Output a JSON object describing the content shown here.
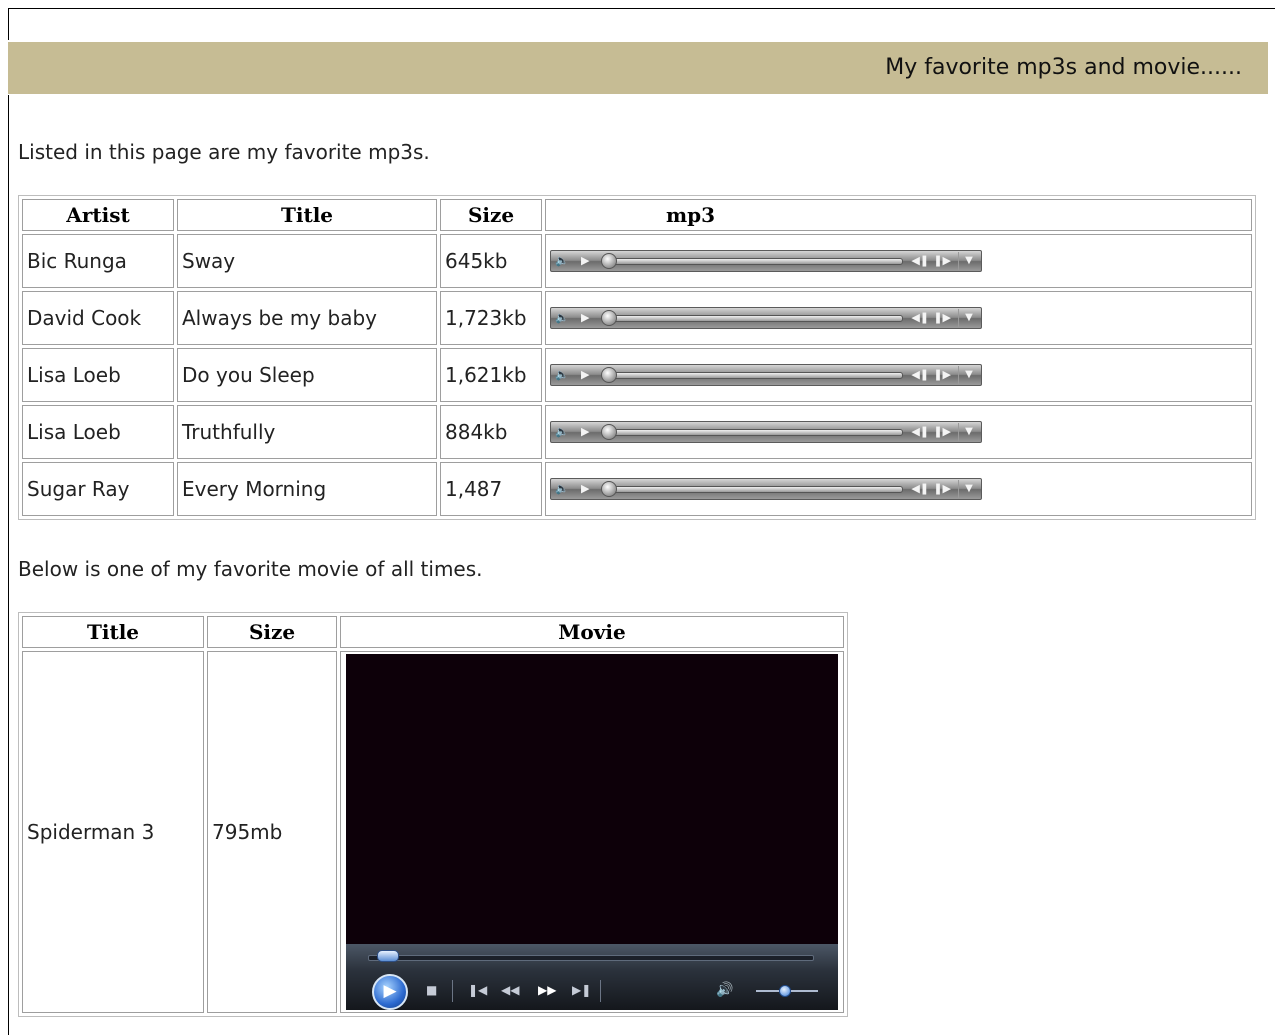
{
  "header": {
    "title": "My favorite mp3s and movie......"
  },
  "intro": "Listed in this page are my favorite mp3s.",
  "mp3_table": {
    "columns": [
      "Artist",
      "Title",
      "Size",
      "mp3"
    ],
    "rows": [
      {
        "artist": "Bic Runga",
        "title": "Sway",
        "size": "645kb"
      },
      {
        "artist": "David Cook",
        "title": "Always be my baby",
        "size": "1,723kb"
      },
      {
        "artist": "Lisa Loeb",
        "title": "Do you Sleep",
        "size": "1,621kb"
      },
      {
        "artist": "Lisa Loeb",
        "title": "Truthfully",
        "size": "884kb"
      },
      {
        "artist": "Sugar Ray",
        "title": "Every Morning",
        "size": "1,487"
      }
    ]
  },
  "movie_intro": "Below is one of my favorite movie of all times.",
  "movie_table": {
    "columns": [
      "Title",
      "Size",
      "Movie"
    ],
    "row": {
      "title": "Spiderman 3",
      "size": "795mb"
    }
  },
  "icons": {
    "mute": "speaker-icon",
    "play": "play-icon",
    "prev": "previous-icon",
    "next": "next-icon",
    "menu": "chevron-down-icon",
    "stop": "stop-icon",
    "rewind": "rewind-icon",
    "fast_forward": "fast-forward-icon",
    "volume": "volume-icon"
  },
  "colors": {
    "banner_bg": "#c6bc94",
    "video_bg": "#0d0009",
    "player_accent": "#2c6ad0"
  },
  "video_player": {
    "seek_progress": 0.02,
    "volume_level": 0.45
  }
}
